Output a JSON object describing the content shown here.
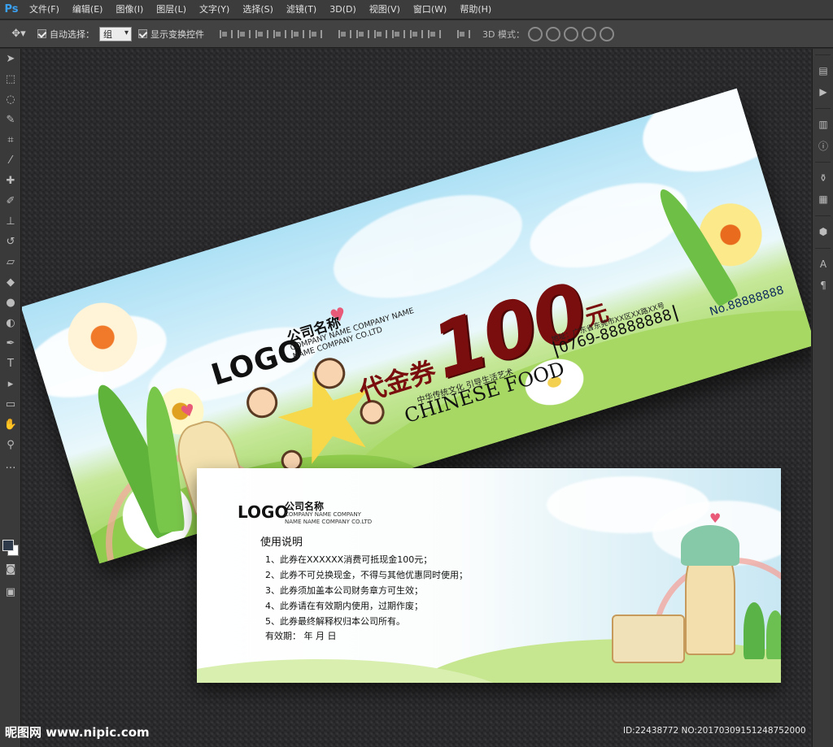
{
  "app": {
    "logo": "Ps",
    "menu": [
      "文件(F)",
      "编辑(E)",
      "图像(I)",
      "图层(L)",
      "文字(Y)",
      "选择(S)",
      "滤镜(T)",
      "3D(D)",
      "视图(V)",
      "窗口(W)",
      "帮助(H)"
    ]
  },
  "options": {
    "tool_icon": "move-tool-icon",
    "auto_select_label": "自动选择：",
    "auto_select_value": "组",
    "show_transform_label": "显示变换控件",
    "mode_3d_label": "3D 模式："
  },
  "voucher_front": {
    "logo": "LOGO",
    "company_cn": "公司名称",
    "company_en": "COMPANY NAME COMPANY NAME NAME COMPANY CO.LTD",
    "title": "代金券",
    "amount": "100",
    "unit": "元",
    "slogan": "中华传统文化 引导生活艺术",
    "brand": "CHINESE FOOD",
    "address": "地址：广东省东莞市XX区XX路XX号",
    "phone": "0769-88888888",
    "serial": "No.88888888"
  },
  "voucher_back": {
    "logo": "LOGO",
    "company_cn": "公司名称",
    "company_en": "COMPANY NAME COMPANY NAME NAME COMPANY CO.LTD",
    "heading": "使用说明",
    "rules": [
      "1、此券在XXXXXX消费可抵现金100元；",
      "2、此券不可兑换现金，不得与其他优惠同时使用；",
      "3、此券须加盖本公司财务章方可生效；",
      "4、此券请在有效期内使用，过期作废；",
      "5、此券最终解释权归本公司所有。"
    ],
    "validity": "有效期：      年    月    日"
  },
  "watermark": {
    "left": "昵图网 www.nipic.com",
    "right": "ID:22438772 NO:20170309151248752000"
  },
  "colors": {
    "accent_red": "#7a0d0d",
    "ps_blue": "#3aa0f0",
    "ui_dark": "#3c3c3c"
  }
}
